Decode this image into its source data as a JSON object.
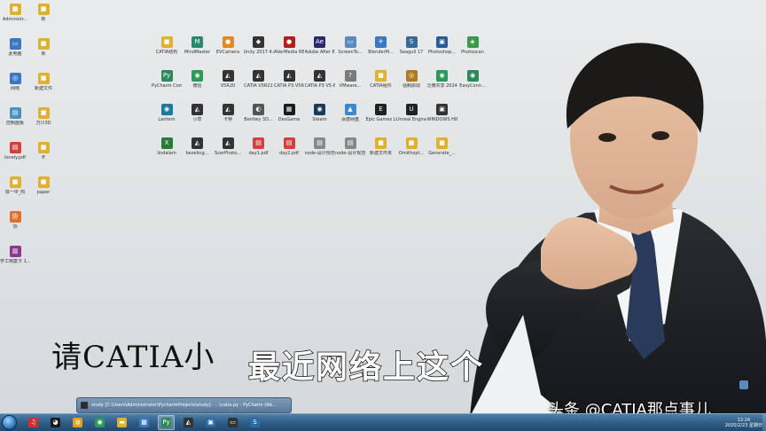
{
  "desktop": {
    "col1": [
      {
        "label": "Administr...",
        "color": "#e0b030",
        "glyph": "■",
        "icon": "user-folder-icon"
      },
      {
        "label": "此电脑",
        "color": "#3a78c2",
        "glyph": "▭",
        "icon": "computer-icon"
      },
      {
        "label": "网络",
        "color": "#3a78c2",
        "glyph": "◎",
        "icon": "network-icon"
      },
      {
        "label": "控制面板",
        "color": "#4a90c0",
        "glyph": "▤",
        "icon": "control-panel-icon"
      },
      {
        "label": "lonely.pdf",
        "color": "#d24040",
        "glyph": "▤",
        "icon": "pdf-icon"
      },
      {
        "label": "铁一中_昀",
        "color": "#e0b030",
        "glyph": "■",
        "icon": "folder-icon"
      },
      {
        "label": "协",
        "color": "#e07030",
        "glyph": "协",
        "icon": "app-icon"
      },
      {
        "label": "学工档案卡 1...",
        "color": "#8a3a8a",
        "glyph": "▥",
        "icon": "winrar-icon"
      }
    ],
    "col2": [
      {
        "label": "新",
        "color": "#e0b030",
        "glyph": "■",
        "icon": "folder-icon"
      },
      {
        "label": "新",
        "color": "#e0b030",
        "glyph": "■",
        "icon": "folder-icon"
      },
      {
        "label": "新建文件",
        "color": "#e0b030",
        "glyph": "■",
        "icon": "folder-icon"
      },
      {
        "label": "万川3D",
        "color": "#e0b030",
        "glyph": "■",
        "icon": "folder-icon"
      },
      {
        "label": "ff",
        "color": "#e0b030",
        "glyph": "■",
        "icon": "folder-icon"
      },
      {
        "label": "paper",
        "color": "#e0b030",
        "glyph": "■",
        "icon": "folder-icon"
      }
    ],
    "grid": [
      [
        {
          "label": "CATIA结构",
          "color": "#e0b030",
          "glyph": "■",
          "icon": "folder-icon"
        },
        {
          "label": "MindMaster",
          "color": "#2a8a6a",
          "glyph": "M",
          "icon": "mindmaster-icon"
        },
        {
          "label": "EVCamera",
          "color": "#e08a20",
          "glyph": "●",
          "icon": "camera-icon"
        },
        {
          "label": "Unity 2017.4.0...",
          "color": "#333333",
          "glyph": "◆",
          "icon": "unity-icon"
        },
        {
          "label": "AVerMedia RECentral",
          "color": "#b02020",
          "glyph": "●",
          "icon": "avermedia-icon"
        },
        {
          "label": "Adobe After Effects CC ...",
          "color": "#2a2a6a",
          "glyph": "Ae",
          "icon": "after-effects-icon"
        },
        {
          "label": "ScreenTo...",
          "color": "#5a8ac0",
          "glyph": "▭",
          "icon": "screen-icon"
        },
        {
          "label": "BlenderM...",
          "color": "#3a78c2",
          "glyph": "✈",
          "icon": "blender-icon"
        },
        {
          "label": "Seagull 17",
          "color": "#3a6a9a",
          "glyph": "S",
          "icon": "seagull-icon"
        },
        {
          "label": "Photoshop...",
          "color": "#2a5a9a",
          "glyph": "▣",
          "icon": "photoshop-icon"
        },
        {
          "label": "Photoscan",
          "color": "#3a9a4a",
          "glyph": "◈",
          "icon": "photoscan-icon"
        }
      ],
      [
        {
          "label": "PyCharm Communit...",
          "color": "#2a8a5a",
          "glyph": "Py",
          "icon": "pycharm-icon"
        },
        {
          "label": "微信",
          "color": "#2a9a5a",
          "glyph": "◉",
          "icon": "wechat-icon"
        },
        {
          "label": "V5R20",
          "color": "#333333",
          "glyph": "◭",
          "icon": "catia-icon"
        },
        {
          "label": "CATIA V5R21",
          "color": "#333333",
          "glyph": "◭",
          "icon": "catia-icon"
        },
        {
          "label": "CATIA P3 V5R21",
          "color": "#333333",
          "glyph": "◭",
          "icon": "catia-icon"
        },
        {
          "label": "CATIA P3 V5-6R2014",
          "color": "#333333",
          "glyph": "◭",
          "icon": "catia-icon"
        },
        {
          "label": "VMware...",
          "color": "#7a7a7a",
          "glyph": "?",
          "icon": "vmware-icon"
        },
        {
          "label": "CATIA组件",
          "color": "#e0b030",
          "glyph": "■",
          "icon": "folder-icon"
        },
        {
          "label": "强制启动",
          "color": "#b07a20",
          "glyph": "◎",
          "icon": "app-icon"
        },
        {
          "label": "泛微共享 2024",
          "color": "#2a9a5a",
          "glyph": "◉",
          "icon": "app-icon"
        },
        {
          "label": "EasyConn...",
          "color": "#2a8a5a",
          "glyph": "◉",
          "icon": "easyconn-icon"
        }
      ],
      [
        {
          "label": "Lantern",
          "color": "#1a7aa0",
          "glyph": "◉",
          "icon": "lantern-icon"
        },
        {
          "label": "小草",
          "color": "#333333",
          "glyph": "◭",
          "icon": "catia-icon"
        },
        {
          "label": "卡特",
          "color": "#333333",
          "glyph": "◭",
          "icon": "catia-icon"
        },
        {
          "label": "Bentley 3D...",
          "color": "#555555",
          "glyph": "◐",
          "icon": "app-icon"
        },
        {
          "label": "DesGame",
          "color": "#1a1a1a",
          "glyph": "▦",
          "icon": "app-icon"
        },
        {
          "label": "Steam",
          "color": "#1a3a5a",
          "glyph": "◉",
          "icon": "steam-icon"
        },
        {
          "label": "百度网盘",
          "color": "#3a8ad0",
          "glyph": "▲",
          "icon": "baidu-netdisk-icon"
        },
        {
          "label": "Epic Games Launcher",
          "color": "#222222",
          "glyph": "E",
          "icon": "epic-games-icon"
        },
        {
          "label": "Unreal Engine",
          "color": "#222222",
          "glyph": "U",
          "icon": "unreal-engine-icon"
        },
        {
          "label": "WINDOWS HIBERN...",
          "color": "#333333",
          "glyph": "▣",
          "icon": "app-icon"
        }
      ],
      [
        {
          "label": "lindalam",
          "color": "#2a7a3a",
          "glyph": "X",
          "icon": "excel-icon"
        },
        {
          "label": "bezeling...",
          "color": "#333333",
          "glyph": "◭",
          "icon": "catia-icon"
        },
        {
          "label": "ScerPhoto...",
          "color": "#333333",
          "glyph": "◭",
          "icon": "catia-icon"
        },
        {
          "label": "day1.pdf",
          "color": "#d24040",
          "glyph": "▤",
          "icon": "pdf-icon"
        },
        {
          "label": "day2.pdf",
          "color": "#d24040",
          "glyph": "▤",
          "icon": "pdf-icon"
        },
        {
          "label": "node-设计规范-文档分享...",
          "color": "#888888",
          "glyph": "▤",
          "icon": "file-icon"
        },
        {
          "label": "node-设计规范-视频.mp4",
          "color": "#888888",
          "glyph": "▤",
          "icon": "file-icon"
        },
        {
          "label": "新建文件夹",
          "color": "#e0b030",
          "glyph": "■",
          "icon": "folder-icon"
        },
        {
          "label": "Ornithopt...",
          "color": "#e0b030",
          "glyph": "■",
          "icon": "folder-icon"
        },
        {
          "label": "Generate_...",
          "color": "#e0b030",
          "glyph": "■",
          "icon": "folder-icon"
        }
      ]
    ]
  },
  "subtitle": {
    "line1": "请CATIA小",
    "line2": "最近网络上这个"
  },
  "watermark": "头条 @CATIA那点事儿",
  "taskbar": {
    "preview_text": "study [C:\\Users\\Administrator\\PycharmProjects\\study] - ...\\catia.py - PyCharm (Ad...",
    "buttons": [
      {
        "icon": "netease-music-icon",
        "color": "#d03030",
        "glyph": "♫",
        "active": false
      },
      {
        "icon": "qq-icon",
        "color": "#1a1a1a",
        "glyph": "◕",
        "active": false
      },
      {
        "icon": "chrome-icon",
        "color": "#e0a020",
        "glyph": "◍",
        "active": false
      },
      {
        "icon": "wechat-icon",
        "color": "#2a9a5a",
        "glyph": "◉",
        "active": false
      },
      {
        "icon": "file-explorer-icon",
        "color": "#e0b030",
        "glyph": "▬",
        "active": false
      },
      {
        "icon": "network-app-icon",
        "color": "#3a78c2",
        "glyph": "▩",
        "active": false
      },
      {
        "icon": "pycharm-icon",
        "color": "#2a8a5a",
        "glyph": "Py",
        "active": true
      },
      {
        "icon": "catia-icon",
        "color": "#333333",
        "glyph": "◭",
        "active": false
      },
      {
        "icon": "screenshot-icon",
        "color": "#2a6aa8",
        "glyph": "▣",
        "active": false
      },
      {
        "icon": "terminal-icon",
        "color": "#333333",
        "glyph": "▭",
        "active": false
      },
      {
        "icon": "seagull-icon",
        "color": "#2a6aa8",
        "glyph": "S",
        "active": false
      }
    ],
    "clock_time": "12:24",
    "clock_date": "2020/2/23 星期日"
  }
}
